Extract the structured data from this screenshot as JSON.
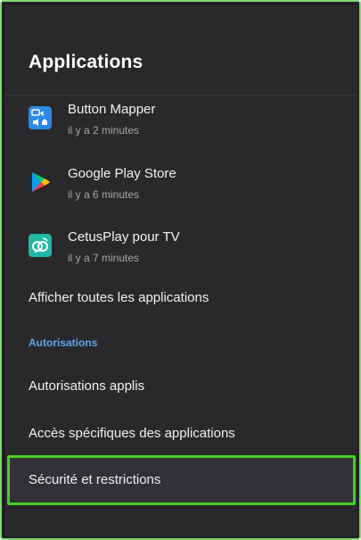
{
  "header": {
    "title": "Applications"
  },
  "recent_apps": [
    {
      "name": "Button Mapper",
      "time": "il y a 2 minutes",
      "icon": "button-mapper-icon"
    },
    {
      "name": "Google Play Store",
      "time": "il y a 6 minutes",
      "icon": "google-play-icon"
    },
    {
      "name": "CetusPlay pour TV",
      "time": "il y a 7 minutes",
      "icon": "cetusplay-icon"
    }
  ],
  "menu": {
    "show_all": "Afficher toutes les applications",
    "section_label": "Autorisations",
    "app_permissions": "Autorisations applis",
    "special_access": "Accès spécifiques des applications",
    "security": "Sécurité et restrictions"
  },
  "colors": {
    "background": "#29292c",
    "section_accent": "#5aa5ee",
    "highlight_border": "#43d21f",
    "outer_border": "#7ddc6a"
  }
}
